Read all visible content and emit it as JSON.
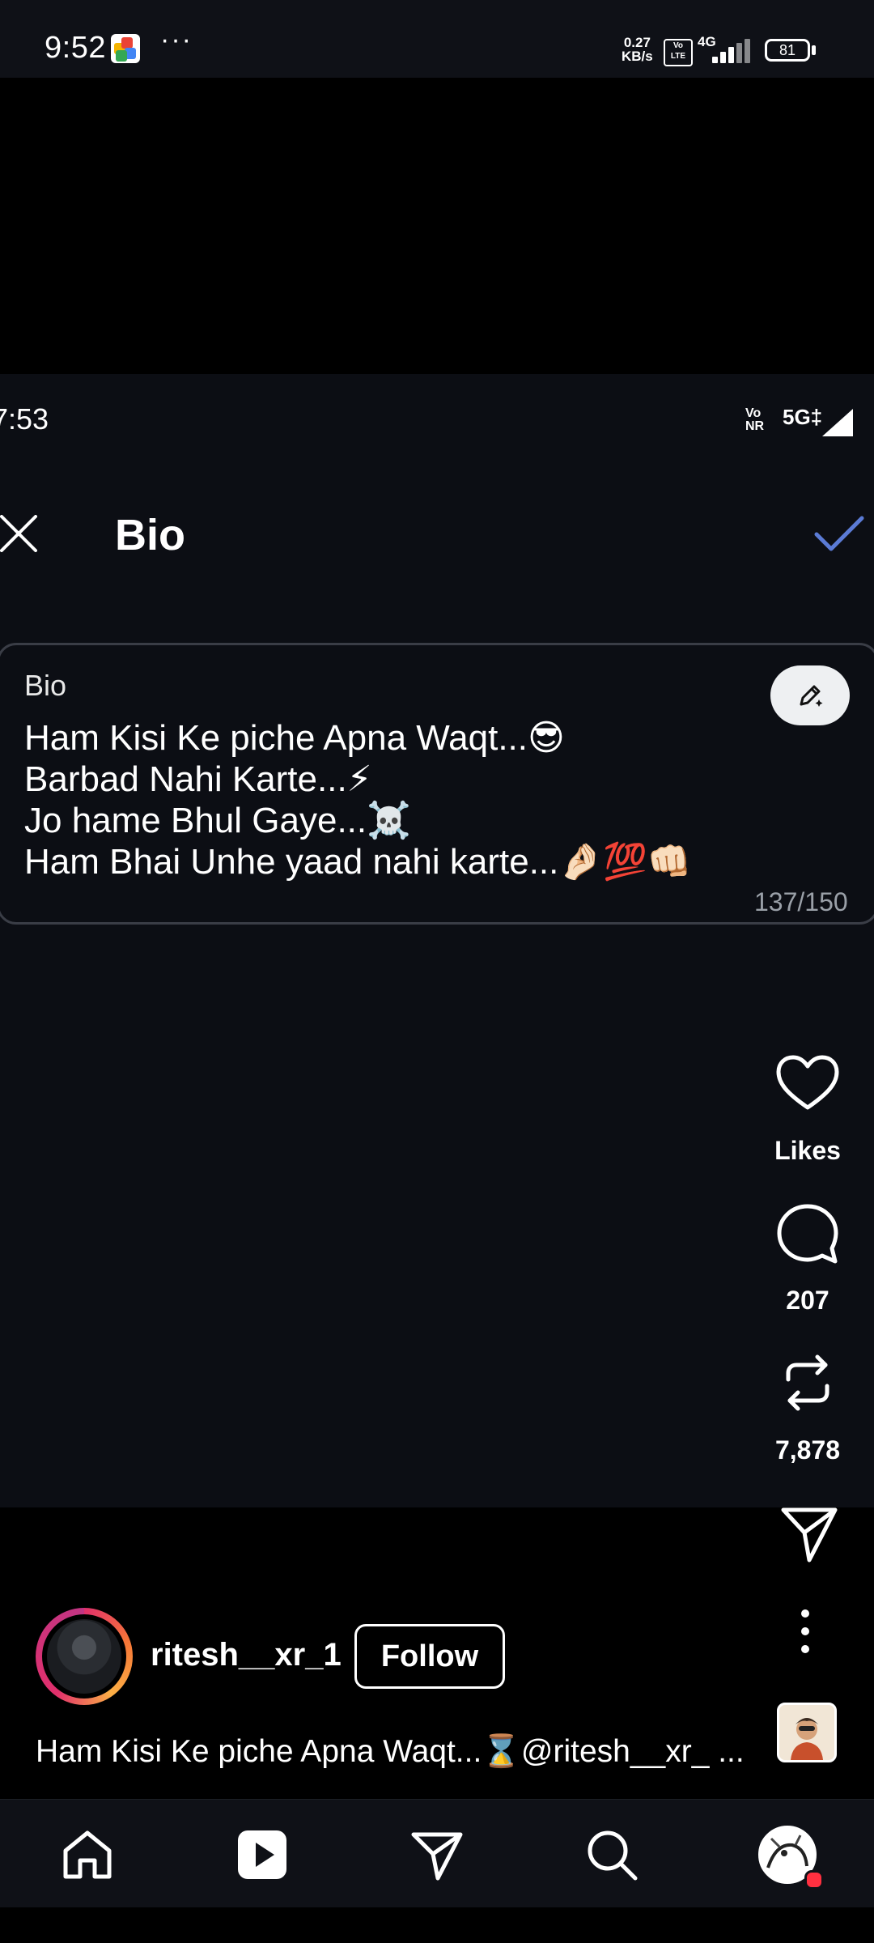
{
  "status_bar": {
    "time": "9:52",
    "dots": "···",
    "net_speed": "0.27\nKB/s",
    "network": "4G",
    "volte": "Vo\nLTE",
    "battery": "81"
  },
  "inner_status": {
    "time": "7:53",
    "vonr": "Vo\nNR",
    "network": "5G‡"
  },
  "header": {
    "title": "Bio"
  },
  "bio_field": {
    "label": "Bio",
    "value": "Ham Kisi Ke piche Apna Waqt...😎\nBarbad Nahi Karte...⚡\nJo hame Bhul Gaye...☠️\nHam Bhai Unhe yaad nahi karte...🤌🏻💯👊🏻",
    "counter": "137/150"
  },
  "rail": {
    "likes_label": "Likes",
    "comments": "207",
    "reposts": "7,878"
  },
  "reel": {
    "username": "ritesh__xr_1",
    "follow_label": "Follow",
    "caption": "Ham Kisi Ke piche Apna Waqt...⌛@ritesh__xr_ ..."
  },
  "icons": {
    "close": "close-icon",
    "check": "check-icon",
    "pen": "pen-icon",
    "heart": "heart-icon",
    "comment": "comment-icon",
    "repost": "repost-icon",
    "share": "send-icon",
    "more": "more-icon",
    "home": "home-icon",
    "reels": "reels-icon",
    "messages": "send-icon",
    "search": "search-icon"
  },
  "colors": {
    "accent_check": "#5b7bd5",
    "background": "#0c0e14",
    "counter": "#9aa0a8"
  }
}
